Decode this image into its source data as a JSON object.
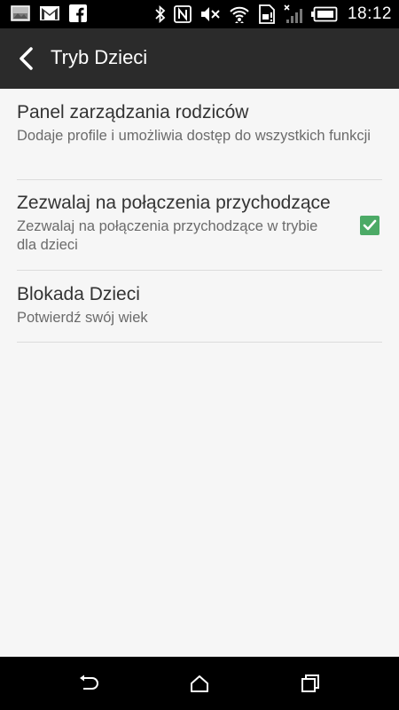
{
  "status_bar": {
    "time": "18:12",
    "left_icons": [
      "image-icon",
      "gmail-icon",
      "facebook-icon"
    ],
    "right_icons": [
      "bluetooth-icon",
      "nfc-icon",
      "mute-icon",
      "wifi-icon",
      "sim-icon",
      "signal-icon",
      "battery-icon"
    ]
  },
  "action_bar": {
    "title": "Tryb Dzieci"
  },
  "preferences": [
    {
      "title": "Panel zarządzania rodziców",
      "summary": "Dodaje profile i umożliwia dostęp do wszystkich funkcji"
    },
    {
      "title": "Zezwalaj na połączenia przychodzące",
      "summary": "Zezwalaj na połączenia przychodzące w trybie dla dzieci",
      "checked": true
    },
    {
      "title": "Blokada Dzieci",
      "summary": "Potwierdź swój wiek"
    }
  ],
  "colors": {
    "checkbox": "#4caa66",
    "action_bar": "#2b2b2b",
    "background": "#f6f6f6"
  },
  "nav_bar": {
    "buttons": [
      "back-nav-icon",
      "home-icon",
      "recents-icon"
    ]
  }
}
